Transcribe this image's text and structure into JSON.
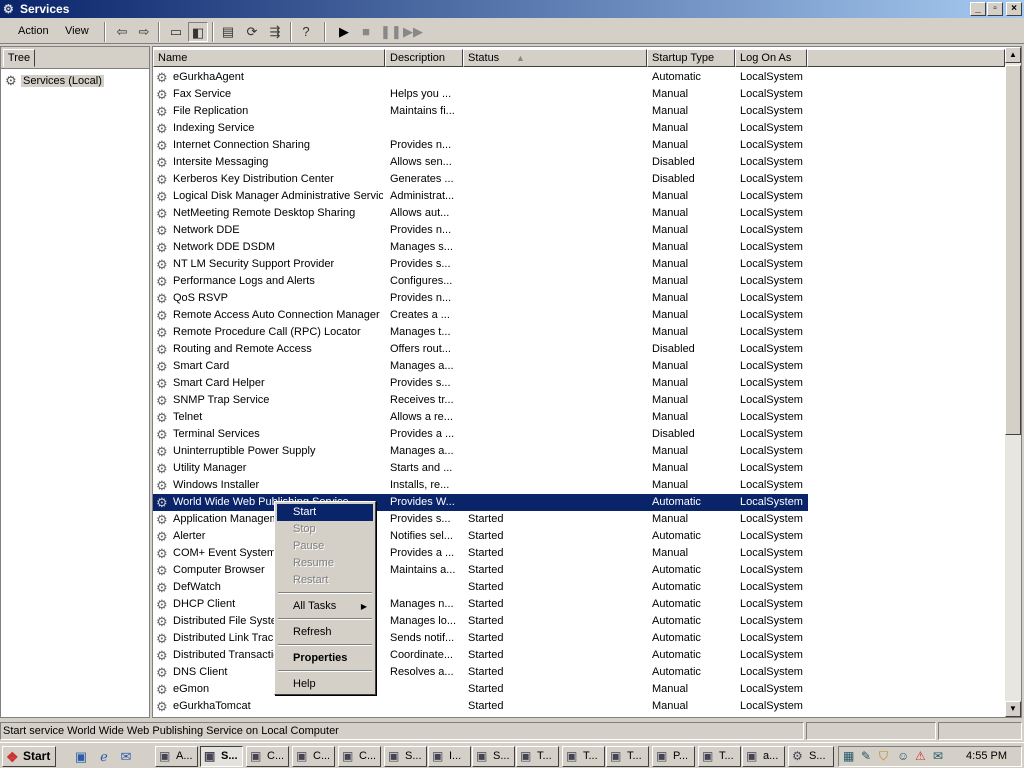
{
  "window": {
    "title": "Services"
  },
  "menu": [
    {
      "label": "Action"
    },
    {
      "label": "View"
    }
  ],
  "toolbar": [
    "back-icon",
    "forward-icon",
    "up-folder-icon",
    "show-tree-icon",
    "properties-icon",
    "refresh-icon",
    "export-list-icon",
    "help-icon",
    "play-icon",
    "stop-icon",
    "pause-icon",
    "restart-icon"
  ],
  "tree": {
    "tab_label": "Tree",
    "root": "Services (Local)"
  },
  "columns": {
    "name": "Name",
    "description": "Description",
    "status": "Status",
    "startup": "Startup Type",
    "logon": "Log On As"
  },
  "rows": [
    {
      "name": "eGurkhaAgent",
      "description": "",
      "status": "",
      "startup": "Automatic",
      "logon": "LocalSystem"
    },
    {
      "name": "Fax Service",
      "description": "Helps you ...",
      "status": "",
      "startup": "Manual",
      "logon": "LocalSystem"
    },
    {
      "name": "File Replication",
      "description": "Maintains fi...",
      "status": "",
      "startup": "Manual",
      "logon": "LocalSystem"
    },
    {
      "name": "Indexing Service",
      "description": "",
      "status": "",
      "startup": "Manual",
      "logon": "LocalSystem"
    },
    {
      "name": "Internet Connection Sharing",
      "description": "Provides n...",
      "status": "",
      "startup": "Manual",
      "logon": "LocalSystem"
    },
    {
      "name": "Intersite Messaging",
      "description": "Allows sen...",
      "status": "",
      "startup": "Disabled",
      "logon": "LocalSystem"
    },
    {
      "name": "Kerberos Key Distribution Center",
      "description": "Generates ...",
      "status": "",
      "startup": "Disabled",
      "logon": "LocalSystem"
    },
    {
      "name": "Logical Disk Manager Administrative Service",
      "description": "Administrat...",
      "status": "",
      "startup": "Manual",
      "logon": "LocalSystem"
    },
    {
      "name": "NetMeeting Remote Desktop Sharing",
      "description": "Allows aut...",
      "status": "",
      "startup": "Manual",
      "logon": "LocalSystem"
    },
    {
      "name": "Network DDE",
      "description": "Provides n...",
      "status": "",
      "startup": "Manual",
      "logon": "LocalSystem"
    },
    {
      "name": "Network DDE DSDM",
      "description": "Manages s...",
      "status": "",
      "startup": "Manual",
      "logon": "LocalSystem"
    },
    {
      "name": "NT LM Security Support Provider",
      "description": "Provides s...",
      "status": "",
      "startup": "Manual",
      "logon": "LocalSystem"
    },
    {
      "name": "Performance Logs and Alerts",
      "description": "Configures...",
      "status": "",
      "startup": "Manual",
      "logon": "LocalSystem"
    },
    {
      "name": "QoS RSVP",
      "description": "Provides n...",
      "status": "",
      "startup": "Manual",
      "logon": "LocalSystem"
    },
    {
      "name": "Remote Access Auto Connection Manager",
      "description": "Creates a ...",
      "status": "",
      "startup": "Manual",
      "logon": "LocalSystem"
    },
    {
      "name": "Remote Procedure Call (RPC) Locator",
      "description": "Manages t...",
      "status": "",
      "startup": "Manual",
      "logon": "LocalSystem"
    },
    {
      "name": "Routing and Remote Access",
      "description": "Offers rout...",
      "status": "",
      "startup": "Disabled",
      "logon": "LocalSystem"
    },
    {
      "name": "Smart Card",
      "description": "Manages a...",
      "status": "",
      "startup": "Manual",
      "logon": "LocalSystem"
    },
    {
      "name": "Smart Card Helper",
      "description": "Provides s...",
      "status": "",
      "startup": "Manual",
      "logon": "LocalSystem"
    },
    {
      "name": "SNMP Trap Service",
      "description": "Receives tr...",
      "status": "",
      "startup": "Manual",
      "logon": "LocalSystem"
    },
    {
      "name": "Telnet",
      "description": "Allows a re...",
      "status": "",
      "startup": "Manual",
      "logon": "LocalSystem"
    },
    {
      "name": "Terminal Services",
      "description": "Provides a ...",
      "status": "",
      "startup": "Disabled",
      "logon": "LocalSystem"
    },
    {
      "name": "Uninterruptible Power Supply",
      "description": "Manages a...",
      "status": "",
      "startup": "Manual",
      "logon": "LocalSystem"
    },
    {
      "name": "Utility Manager",
      "description": "Starts and ...",
      "status": "",
      "startup": "Manual",
      "logon": "LocalSystem"
    },
    {
      "name": "Windows Installer",
      "description": "Installs, re...",
      "status": "",
      "startup": "Manual",
      "logon": "LocalSystem"
    },
    {
      "name": "World Wide Web Publishing Service",
      "description": "Provides W...",
      "status": "",
      "startup": "Automatic",
      "logon": "LocalSystem",
      "selected": true
    },
    {
      "name": "Application Management",
      "description": "Provides s...",
      "status": "Started",
      "startup": "Manual",
      "logon": "LocalSystem"
    },
    {
      "name": "Alerter",
      "description": "Notifies sel...",
      "status": "Started",
      "startup": "Automatic",
      "logon": "LocalSystem"
    },
    {
      "name": "COM+ Event System",
      "description": "Provides a ...",
      "status": "Started",
      "startup": "Manual",
      "logon": "LocalSystem"
    },
    {
      "name": "Computer Browser",
      "description": "Maintains a...",
      "status": "Started",
      "startup": "Automatic",
      "logon": "LocalSystem"
    },
    {
      "name": "DefWatch",
      "description": "",
      "status": "Started",
      "startup": "Automatic",
      "logon": "LocalSystem"
    },
    {
      "name": "DHCP Client",
      "description": "Manages n...",
      "status": "Started",
      "startup": "Automatic",
      "logon": "LocalSystem"
    },
    {
      "name": "Distributed File System",
      "description": "Manages lo...",
      "status": "Started",
      "startup": "Automatic",
      "logon": "LocalSystem"
    },
    {
      "name": "Distributed Link Tracking Client",
      "description": "Sends notif...",
      "status": "Started",
      "startup": "Automatic",
      "logon": "LocalSystem"
    },
    {
      "name": "Distributed Transaction Coordinator",
      "description": "Coordinate...",
      "status": "Started",
      "startup": "Automatic",
      "logon": "LocalSystem"
    },
    {
      "name": "DNS Client",
      "description": "Resolves a...",
      "status": "Started",
      "startup": "Automatic",
      "logon": "LocalSystem"
    },
    {
      "name": "eGmon",
      "description": "",
      "status": "Started",
      "startup": "Manual",
      "logon": "LocalSystem"
    },
    {
      "name": "eGurkhaTomcat",
      "description": "",
      "status": "Started",
      "startup": "Manual",
      "logon": "LocalSystem"
    }
  ],
  "context_menu": {
    "start": "Start",
    "stop": "Stop",
    "pause": "Pause",
    "resume": "Resume",
    "restart": "Restart",
    "all_tasks": "All Tasks",
    "refresh": "Refresh",
    "properties": "Properties",
    "help": "Help"
  },
  "status_bar": {
    "text": "Start service World Wide Web Publishing Service on Local Computer"
  },
  "taskbar": {
    "start_label": "Start",
    "quick_launch": [
      "show-desktop-icon",
      "ie-icon",
      "outlook-icon"
    ],
    "tasks": [
      "A...",
      "S...",
      "C...",
      "C...",
      "C...",
      "S...",
      "I...",
      "S...",
      "T...",
      "T...",
      "T...",
      "P...",
      "T...",
      "a...",
      "S..."
    ],
    "active_task_index": 1,
    "clock": "4:55 PM"
  },
  "colors": {
    "selection": "#0a246a",
    "face": "#d4d0c8"
  }
}
